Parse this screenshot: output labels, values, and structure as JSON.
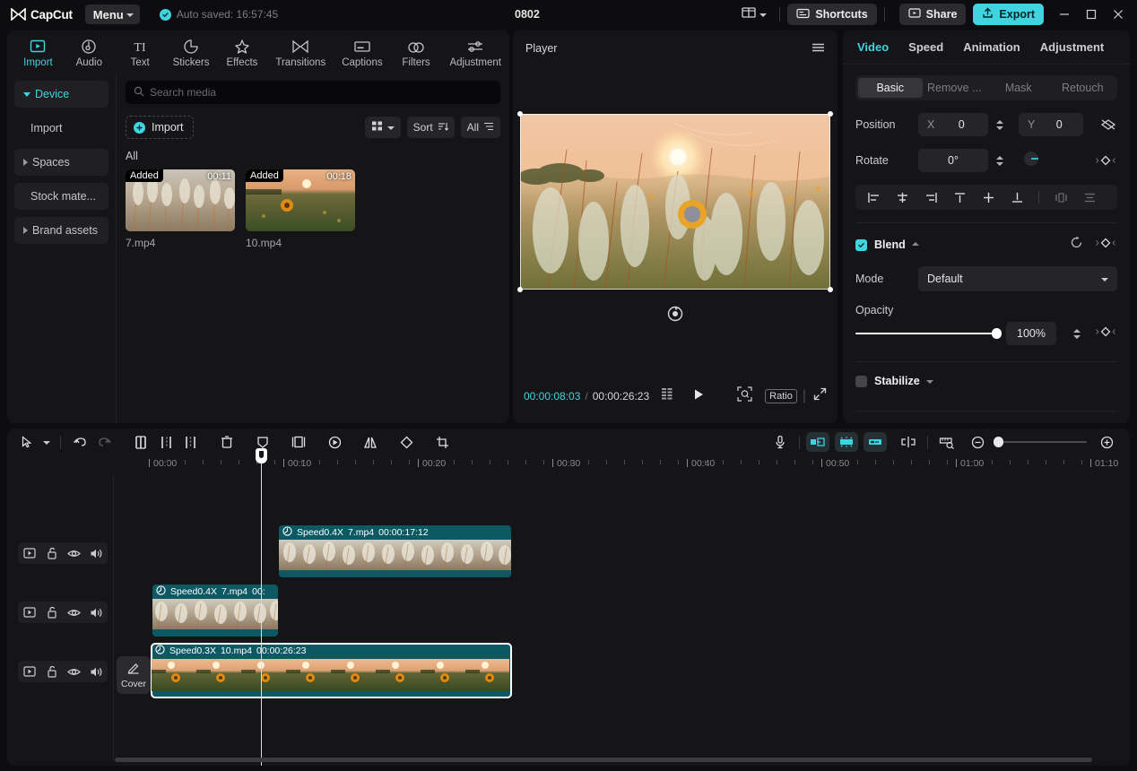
{
  "titlebar": {
    "brand": "CapCut",
    "menu_label": "Menu",
    "autosave_text": "Auto saved: 16:57:45",
    "project_title": "0802",
    "shortcuts_label": "Shortcuts",
    "share_label": "Share",
    "export_label": "Export",
    "icons": {
      "layout": "layout-icon",
      "shortcuts": "keyboard-icon",
      "share": "share-icon",
      "export": "upload-icon",
      "minimize": "minimize-icon",
      "maximize": "maximize-icon",
      "close": "close-icon"
    }
  },
  "nav_tabs": [
    {
      "label": "Import",
      "icon": "import-icon",
      "active": true
    },
    {
      "label": "Audio",
      "icon": "audio-icon",
      "active": false
    },
    {
      "label": "Text",
      "icon": "text-icon",
      "active": false
    },
    {
      "label": "Stickers",
      "icon": "sticker-icon",
      "active": false
    },
    {
      "label": "Effects",
      "icon": "effects-icon",
      "active": false
    },
    {
      "label": "Transitions",
      "icon": "transitions-icon",
      "active": false
    },
    {
      "label": "Captions",
      "icon": "captions-icon",
      "active": false
    },
    {
      "label": "Filters",
      "icon": "filters-icon",
      "active": false
    },
    {
      "label": "Adjustment",
      "icon": "adjustment-icon",
      "active": false
    }
  ],
  "media_sidebar": [
    {
      "label": "Device",
      "expandable": true,
      "active": true
    },
    {
      "label": "Import",
      "expandable": false,
      "active": false
    },
    {
      "label": "Spaces",
      "expandable": true,
      "active": false
    },
    {
      "label": "Stock mate...",
      "expandable": false,
      "active": false
    },
    {
      "label": "Brand assets",
      "expandable": true,
      "active": false
    }
  ],
  "media": {
    "search_placeholder": "Search media",
    "import_label": "Import",
    "sort_label": "Sort",
    "filter_label": "All",
    "group_label": "All",
    "items": [
      {
        "name": "7.mp4",
        "duration": "00:11",
        "badge": "Added"
      },
      {
        "name": "10.mp4",
        "duration": "00:18",
        "badge": "Added"
      }
    ]
  },
  "player": {
    "title": "Player",
    "current_time": "00:00:08:03",
    "total_time": "00:00:26:23",
    "ratio_label": "Ratio",
    "icons": {
      "menu": "hamburger-icon",
      "reset": "reset-rotation-icon",
      "quality": "quality-icon",
      "play": "play-icon",
      "zoom": "zoom-fit-icon",
      "fullscreen": "fullscreen-icon"
    }
  },
  "inspector": {
    "tabs": [
      {
        "label": "Video",
        "active": true
      },
      {
        "label": "Speed",
        "active": false
      },
      {
        "label": "Animation",
        "active": false
      },
      {
        "label": "Adjustment",
        "active": false
      }
    ],
    "segments": [
      {
        "label": "Basic",
        "active": true
      },
      {
        "label": "Remove ...",
        "active": false
      },
      {
        "label": "Mask",
        "active": false
      },
      {
        "label": "Retouch",
        "active": false
      }
    ],
    "position": {
      "label": "Position",
      "x_axis": "X",
      "x_value": "0",
      "y_axis": "Y",
      "y_value": "0"
    },
    "rotate": {
      "label": "Rotate",
      "value": "0°"
    },
    "blend": {
      "label": "Blend",
      "checked": true,
      "mode_label": "Mode",
      "mode_value": "Default",
      "opacity_label": "Opacity",
      "opacity_value": "100%",
      "opacity_percent": 100
    },
    "stabilize": {
      "label": "Stabilize",
      "checked": false
    },
    "align_buttons": [
      "align-left-icon",
      "align-center-horizontal-icon",
      "align-right-icon",
      "align-top-icon",
      "align-middle-vertical-icon",
      "align-bottom-icon",
      "distribute-horizontal-icon",
      "distribute-vertical-icon"
    ]
  },
  "timeline": {
    "toolbar_left": [
      "select-tool-icon",
      "tool-dropdown-icon",
      "undo-icon",
      "redo-icon",
      "split-icon",
      "trim-left-icon",
      "trim-right-icon",
      "delete-icon",
      "freeze-icon",
      "crop-frame-icon",
      "reverse-icon",
      "mirror-icon",
      "rotate-icon",
      "crop-icon"
    ],
    "toolbar_right": [
      "mic-icon",
      "fade-in-icon",
      "keyframe-icon",
      "fade-out-icon",
      "split-marker-icon",
      "measure-icon",
      "zoom-out-icon",
      "zoom-in-icon"
    ],
    "ruler_labels": [
      "00:00",
      "00:10",
      "00:20",
      "00:30",
      "00:40",
      "00:50",
      "01:00",
      "01:10"
    ],
    "playhead_time": "00:00:08:03",
    "cover_label": "Cover",
    "track_head_icons": [
      "track-thumb-icon",
      "lock-icon",
      "eye-icon",
      "volume-icon"
    ],
    "clips": [
      {
        "track": 0,
        "speed": "Speed0.4X",
        "name": "7.mp4",
        "duration": "00:00:17:12",
        "selected": false,
        "kind": "reeds"
      },
      {
        "track": 1,
        "speed": "Speed0.4X",
        "name": "7.mp4",
        "duration": "00:",
        "selected": false,
        "kind": "reeds"
      },
      {
        "track": 2,
        "speed": "Speed0.3X",
        "name": "10.mp4",
        "duration": "00:00:26:23",
        "selected": true,
        "kind": "sunflower"
      }
    ]
  },
  "colors": {
    "accent": "#3fd4e0",
    "panel": "#151517",
    "window": "#0d0d0f",
    "clip": "#0d5963",
    "text": "#d8d8d8"
  }
}
